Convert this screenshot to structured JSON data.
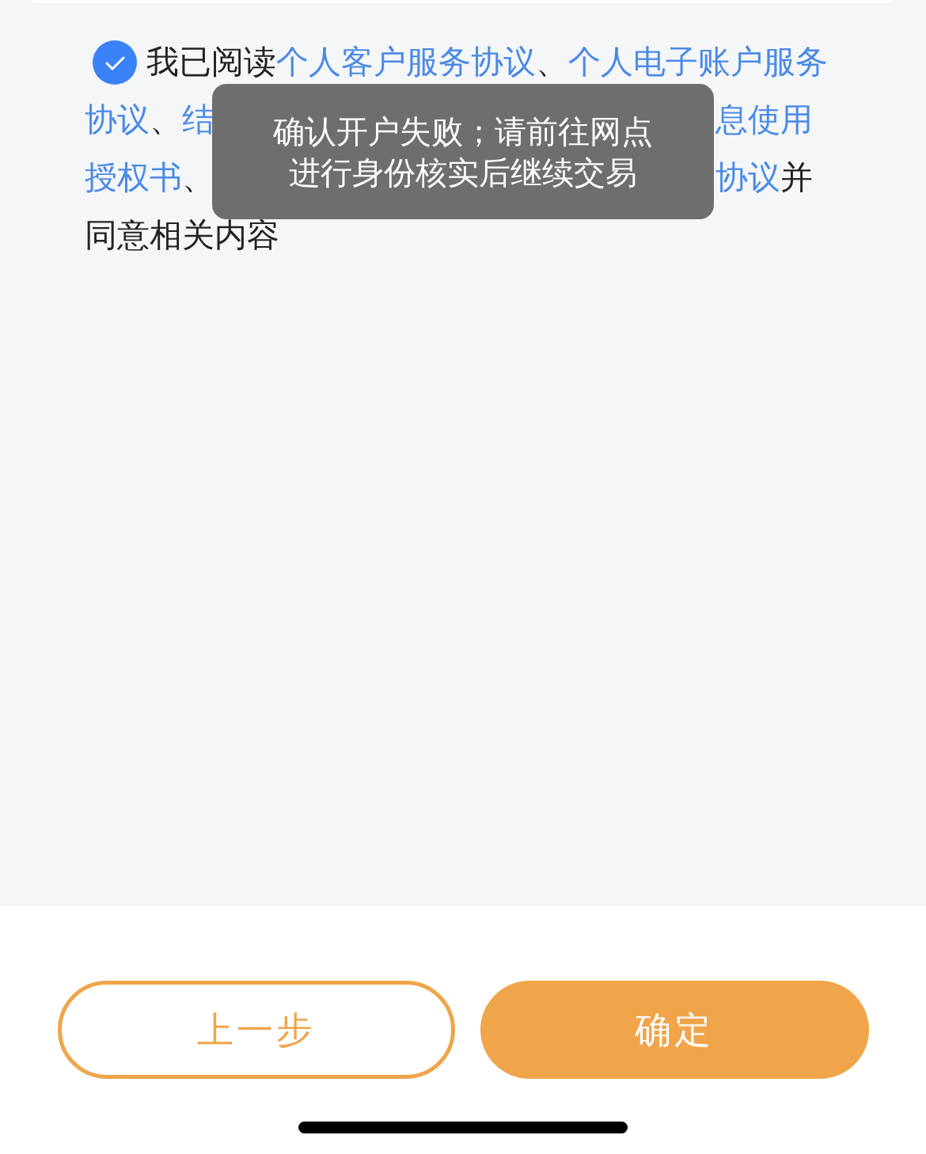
{
  "agreement": {
    "checked": true,
    "lines": [
      {
        "left": [
          {
            "kind": "plain",
            "text": "我已阅读"
          },
          {
            "kind": "link",
            "text": "个人客户服务协议"
          },
          {
            "kind": "plain",
            "text": "、"
          },
          {
            "kind": "link",
            "text": "个人电子账户服务"
          }
        ]
      },
      {
        "left": [
          {
            "kind": "link",
            "text": "协议"
          },
          {
            "kind": "plain",
            "text": "、"
          },
          {
            "kind": "link",
            "text": "结"
          }
        ],
        "right": [
          {
            "kind": "link",
            "text": "息使用"
          }
        ]
      },
      {
        "left": [
          {
            "kind": "link",
            "text": "授权书"
          },
          {
            "kind": "plain",
            "text": "、"
          }
        ],
        "right": [
          {
            "kind": "link",
            "text": "协议"
          },
          {
            "kind": "plain",
            "text": "并"
          }
        ]
      },
      {
        "left": [
          {
            "kind": "plain",
            "text": "同意相关内容"
          }
        ]
      }
    ]
  },
  "toast": {
    "lines": [
      "确认开户失败；请前往网点",
      "进行身份核实后继续交易"
    ]
  },
  "buttons": [
    {
      "kind": "outline",
      "label": "上一步"
    },
    {
      "kind": "filled",
      "label": "确定"
    }
  ]
}
